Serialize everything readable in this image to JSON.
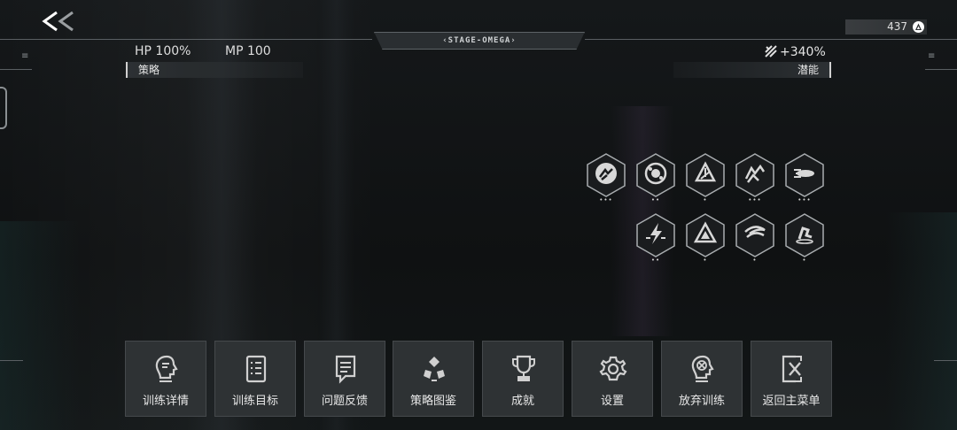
{
  "header": {
    "back_icon": "double-chevron-left-icon",
    "stage_title": "‹STAGE-OMEGA›",
    "currency_value": "437",
    "currency_icon": "a-circle-icon"
  },
  "stats": {
    "hp": "HP 100%",
    "mp": "MP 100",
    "potential_value": "+340%",
    "potential_icon": "slash-burst-icon"
  },
  "sections": {
    "left_label": "策略",
    "right_label": "潜能"
  },
  "skills": [
    {
      "icon": "dashing-figure-icon",
      "dots": "•••"
    },
    {
      "icon": "spiral-orb-icon",
      "dots": "••"
    },
    {
      "icon": "triangular-star-icon",
      "dots": "•"
    },
    {
      "icon": "running-figures-icon",
      "dots": "•••"
    },
    {
      "icon": "speed-streak-icon",
      "dots": "•••"
    },
    {
      "icon": "lightning-strike-icon",
      "dots": "••"
    },
    {
      "icon": "triangle-target-icon",
      "dots": "•"
    },
    {
      "icon": "wind-slash-icon",
      "dots": "•"
    },
    {
      "icon": "leaping-figure-icon",
      "dots": "•"
    }
  ],
  "menu": [
    {
      "label": "训练详情",
      "icon": "head-profile-icon"
    },
    {
      "label": "训练目标",
      "icon": "checklist-icon"
    },
    {
      "label": "问题反馈",
      "icon": "feedback-doc-icon"
    },
    {
      "label": "策略图鉴",
      "icon": "tri-node-icon"
    },
    {
      "label": "成就",
      "icon": "trophy-icon"
    },
    {
      "label": "设置",
      "icon": "gear-icon"
    },
    {
      "label": "放弃训练",
      "icon": "head-cross-icon"
    },
    {
      "label": "返回主菜单",
      "icon": "exit-door-icon"
    }
  ]
}
